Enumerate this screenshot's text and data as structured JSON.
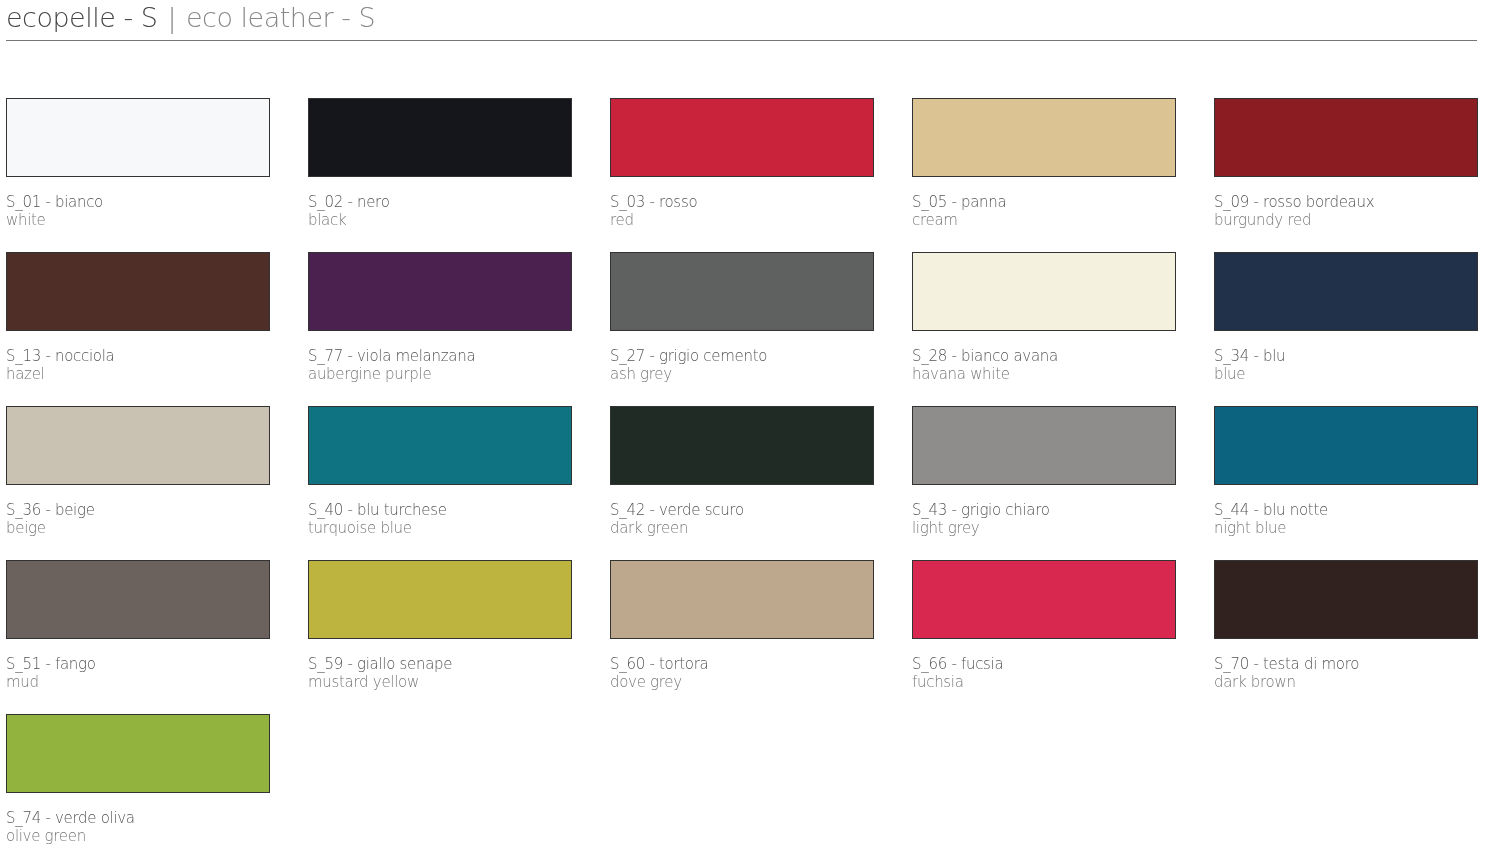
{
  "title": {
    "italian": "ecopelle - S",
    "separator": "|",
    "english": "eco leather - S"
  },
  "swatches": [
    {
      "code": "S_01 - bianco",
      "name": "white",
      "color": "#f7f8f9"
    },
    {
      "code": "S_02 - nero",
      "name": "black",
      "color": "#14161b"
    },
    {
      "code": "S_03 - rosso",
      "name": "red",
      "color": "#c8233a"
    },
    {
      "code": "S_05 - panna",
      "name": "cream",
      "color": "#dcc394"
    },
    {
      "code": "S_09 - rosso bordeaux",
      "name": "burgundy red",
      "color": "#8a1c22"
    },
    {
      "code": "S_13 - nocciola",
      "name": "hazel",
      "color": "#4e2e27"
    },
    {
      "code": "S_77 - viola melanzana",
      "name": "aubergine purple",
      "color": "#4b2150"
    },
    {
      "code": "S_27 - grigio cemento",
      "name": "ash grey",
      "color": "#5f6060"
    },
    {
      "code": "S_28 - bianco avana",
      "name": "havana white",
      "color": "#f5f1df"
    },
    {
      "code": "S_34 - blu",
      "name": "blue",
      "color": "#22314a"
    },
    {
      "code": "S_36 - beige",
      "name": "beige",
      "color": "#c9c1b2"
    },
    {
      "code": "S_40 - blu turchese",
      "name": "turquoise blue",
      "color": "#0f7382"
    },
    {
      "code": "S_42 - verde scuro",
      "name": "dark green",
      "color": "#1f2b24"
    },
    {
      "code": "S_43 - grigio chiaro",
      "name": "light grey",
      "color": "#8e8d8c"
    },
    {
      "code": "S_44 - blu notte",
      "name": "night blue",
      "color": "#0c6380"
    },
    {
      "code": "S_51 - fango",
      "name": "mud",
      "color": "#6b625d"
    },
    {
      "code": "S_59 - giallo senape",
      "name": "mustard yellow",
      "color": "#bcb43f"
    },
    {
      "code": "S_60 - tortora",
      "name": "dove grey",
      "color": "#bda88e"
    },
    {
      "code": "S_66 - fucsia",
      "name": "fuchsia",
      "color": "#d8284f"
    },
    {
      "code": "S_70 - testa di moro",
      "name": "dark brown",
      "color": "#32221f"
    },
    {
      "code": "S_74 - verde oliva",
      "name": "olive green",
      "color": "#92b43f"
    }
  ]
}
